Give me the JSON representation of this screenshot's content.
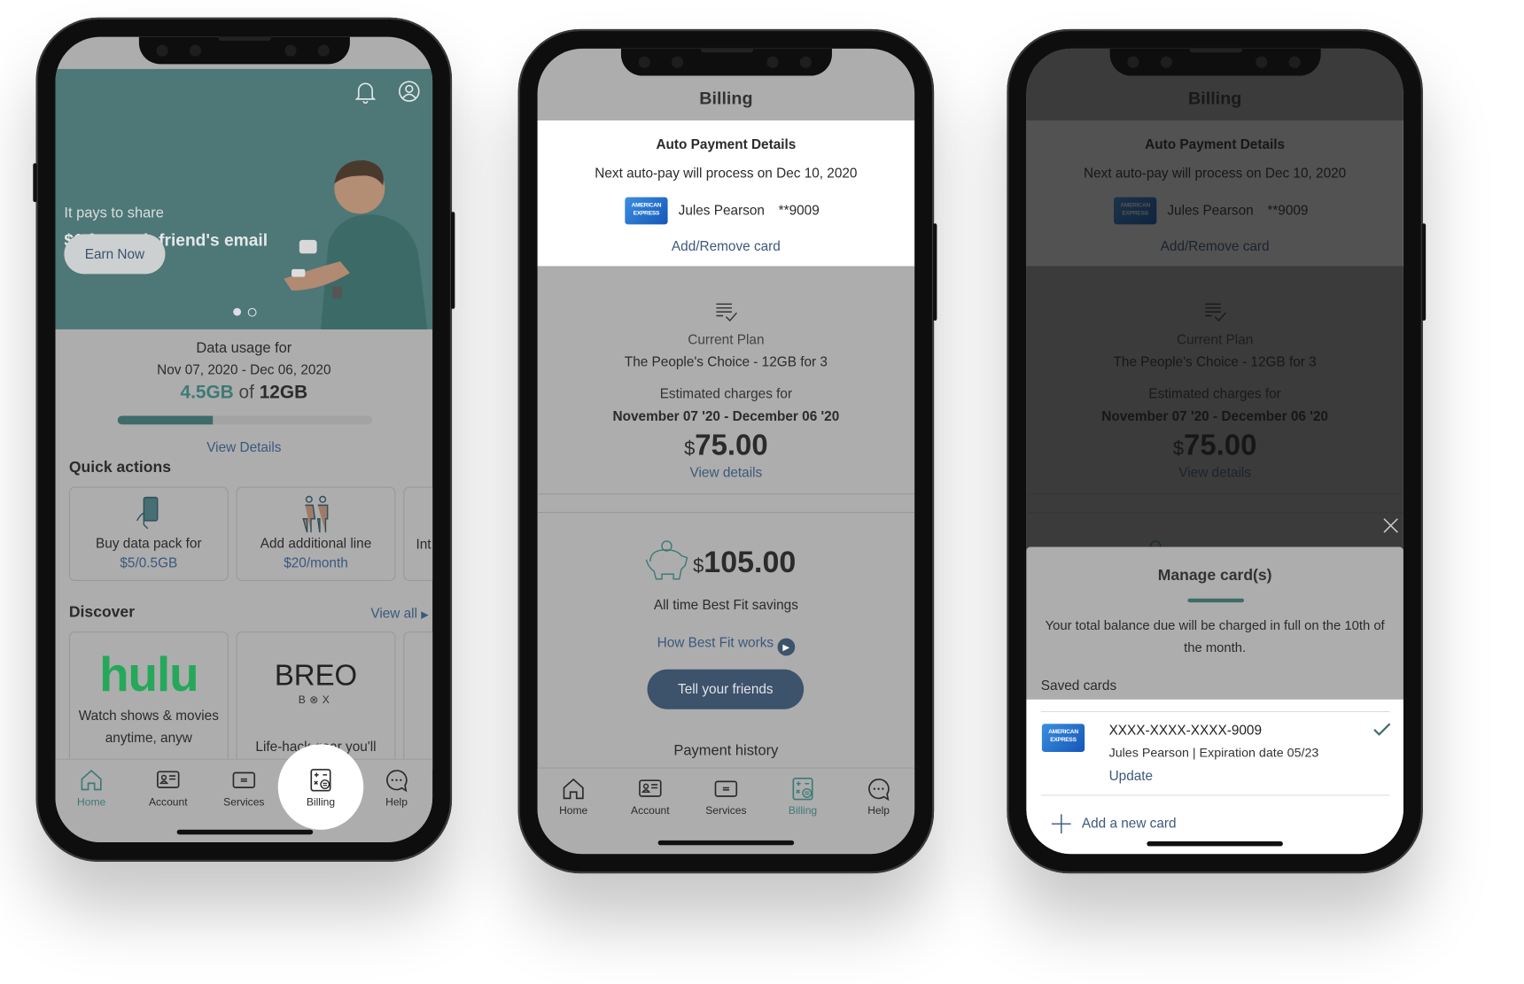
{
  "colors": {
    "brand_teal": "#3e7a76",
    "link_blue": "#3a587c",
    "button_navy": "#3d526b",
    "hero_bg": "#4e7777",
    "hulu_green": "#25a85a"
  },
  "home": {
    "hero": {
      "subtitle": "It pays to share",
      "title": "$1 for each friend's email",
      "cta": "Earn Now",
      "carousel": {
        "count": 2,
        "active": 1
      }
    },
    "usage": {
      "label": "Data usage for",
      "period": "Nov 07, 2020 - Dec 06, 2020",
      "used": "4.5GB",
      "of": "of",
      "total": "12GB",
      "used_fraction": 0.375,
      "view_details": "View Details"
    },
    "quick_actions": {
      "title": "Quick actions",
      "items": [
        {
          "label": "Buy data pack for",
          "price": "$5/0.5GB",
          "icon": "phone-hand-icon"
        },
        {
          "label": "Add additional line",
          "price": "$20/month",
          "icon": "people-icon"
        },
        {
          "label": "Int"
        }
      ]
    },
    "discover": {
      "title": "Discover",
      "view_all": "View all",
      "items": [
        {
          "logo": "hulu",
          "desc": "Watch shows & movies anytime, anyw"
        },
        {
          "logo": "BREO",
          "logo_sub": "B⊗X",
          "desc": "Life-hack gear you'll"
        }
      ]
    }
  },
  "nav": {
    "items": [
      {
        "label": "Home",
        "icon": "home-icon"
      },
      {
        "label": "Account",
        "icon": "account-card-icon"
      },
      {
        "label": "Services",
        "icon": "services-icon"
      },
      {
        "label": "Billing",
        "icon": "calculator-icon"
      },
      {
        "label": "Help",
        "icon": "chat-icon"
      }
    ]
  },
  "billing": {
    "title": "Billing",
    "auto_payment": {
      "heading": "Auto Payment Details",
      "next": "Next auto-pay will process on Dec 10, 2020",
      "card_brand": "AMERICAN EXPRESS",
      "card_holder": "Jules Pearson",
      "card_last4": "**9009",
      "add_remove": "Add/Remove card"
    },
    "plan": {
      "label": "Current Plan",
      "name": "The People's Choice - 12GB for 3",
      "estimated_label": "Estimated charges for",
      "period": "November 07 '20 - December 06 '20",
      "currency": "$",
      "amount": "75.00",
      "view_details": "View details"
    },
    "savings": {
      "currency": "$",
      "amount": "105.00",
      "label": "All time Best Fit savings",
      "how_link": "How Best Fit works",
      "cta": "Tell your friends"
    },
    "payment_history": "Payment history"
  },
  "manage_cards": {
    "title": "Manage card(s)",
    "description": "Your total balance due will be charged in full on the 10th of the month.",
    "saved_cards_label": "Saved cards",
    "cards": [
      {
        "number": "XXXX-XXXX-XXXX-9009",
        "details": "Jules Pearson | Expiration date 05/23",
        "update": "Update",
        "selected": true
      }
    ],
    "add_card": "Add a new card"
  }
}
